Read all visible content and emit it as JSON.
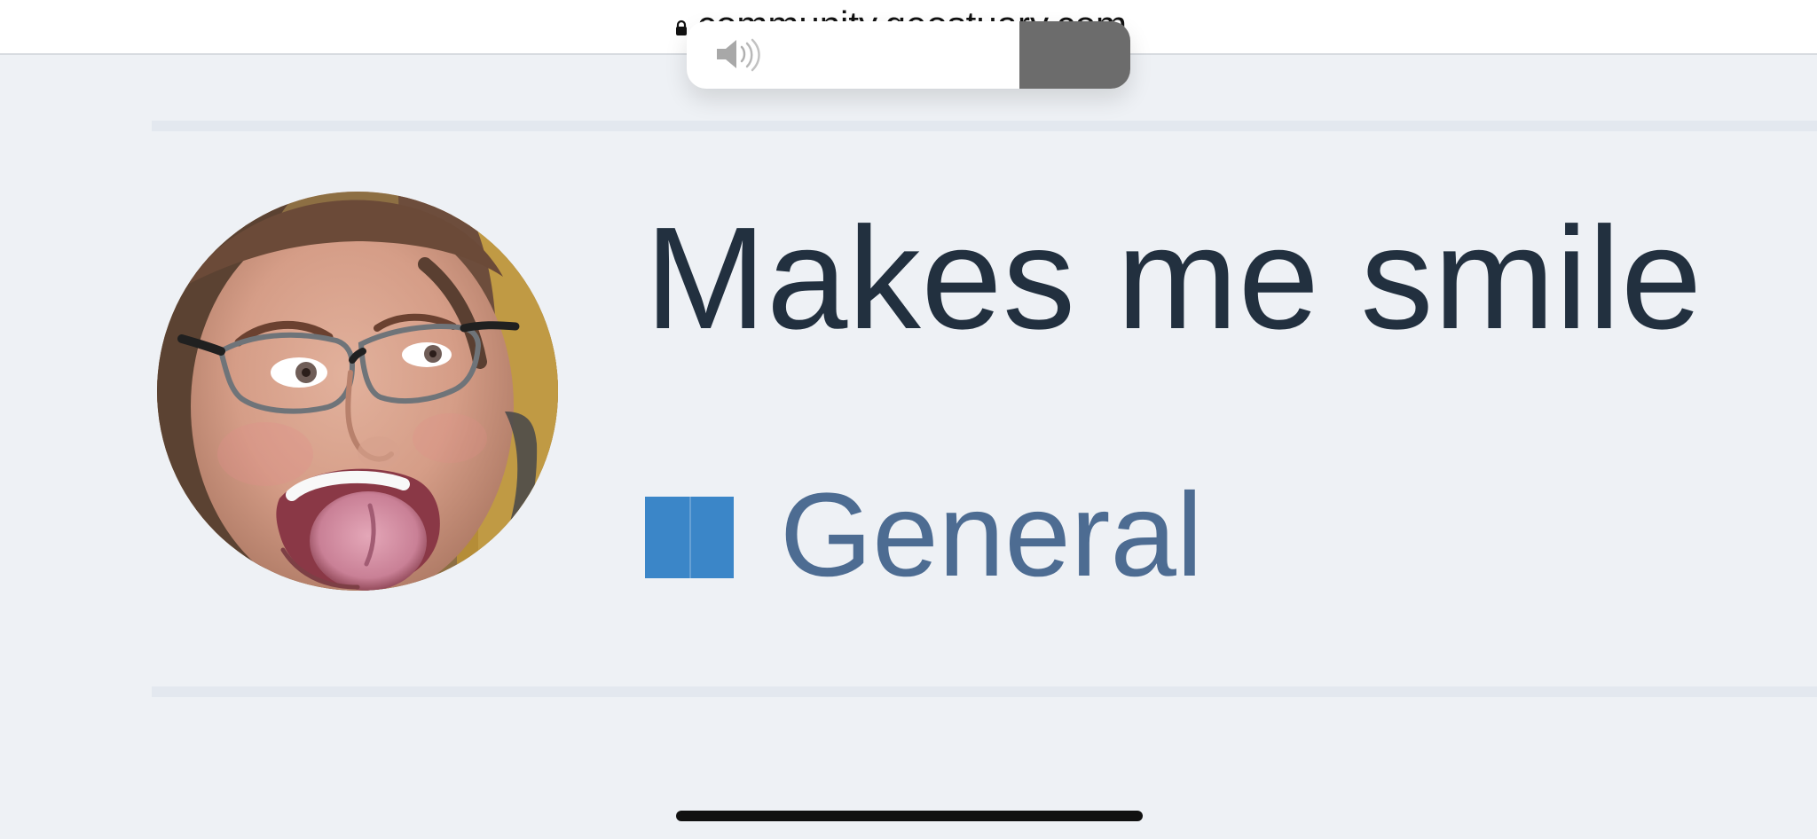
{
  "browser": {
    "url": "community.geostuary.com",
    "lock_icon": "lock-icon"
  },
  "volume_hud": {
    "icon": "speaker-icon",
    "level": 0.25
  },
  "topic": {
    "title": "Makes me smile",
    "category": {
      "label": "General",
      "color": "#3b86c8"
    }
  },
  "avatar": {
    "kind": "profile-photo"
  }
}
